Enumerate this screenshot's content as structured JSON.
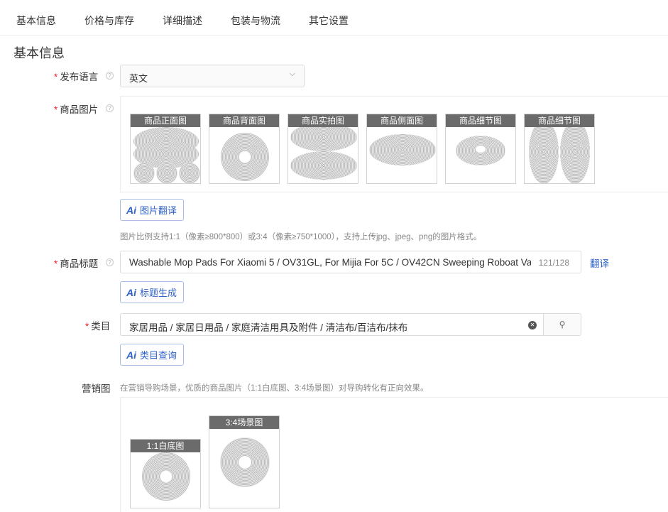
{
  "tabs": [
    "基本信息",
    "价格与库存",
    "详细描述",
    "包装与物流",
    "其它设置"
  ],
  "section_title": "基本信息",
  "language": {
    "label": "发布语言",
    "value": "英文"
  },
  "product_images": {
    "label": "商品图片",
    "captions": [
      "商品正面图",
      "商品背面图",
      "商品实拍图",
      "商品侧面图",
      "商品细节图",
      "商品细节图"
    ],
    "translate_button": "图片翻译",
    "hint": "图片比例支持1:1（像素≥800*800）或3:4（像素≥750*1000），支持上传jpg、jpeg、png的图片格式。"
  },
  "product_title": {
    "label": "商品标题",
    "value": "Washable Mop Pads For Xiaomi 5 / OV31GL, For Mijia For 5C / OV42CN Sweeping Roboat Vacuum Cleaner",
    "count": "121/128",
    "translate_link": "翻译",
    "generate_button": "标题生成"
  },
  "category": {
    "label": "类目",
    "value": "家居用品 / 家居日用品 / 家庭清洁用具及附件 / 清洁布/百洁布/抹布",
    "query_button": "类目查询"
  },
  "marketing": {
    "label": "营销图",
    "hint": "在营销导购场景，优质的商品图片（1:1白底图、3:4场景图）对导购转化有正向效果。",
    "captions": [
      "1:1白底图",
      "3:4场景图"
    ]
  },
  "colors": {
    "accent": "#2f62c9",
    "required": "#f5222d"
  },
  "icons": {
    "dropdown": "chevron-down-icon",
    "help": "question-circle-icon",
    "clear": "clear-icon",
    "search": "search-icon"
  }
}
